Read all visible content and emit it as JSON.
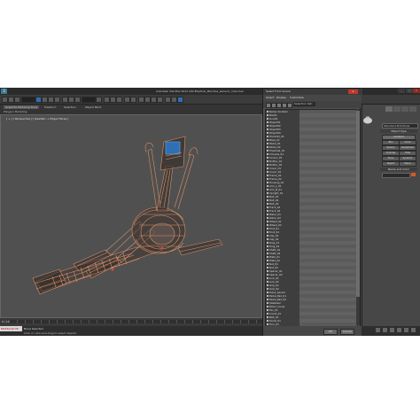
{
  "app": {
    "logo": "3",
    "title": "Autodesk 3ds Max 2013 x64     Elliptical_Machine_Generic_max.max"
  },
  "ribbon": {
    "tabs": [
      "Graphite Modeling Tools",
      "Freeform",
      "Selection",
      "Object Paint"
    ],
    "sub_label": "Polygon Modeling"
  },
  "viewport": {
    "label": "[ + ] [ Perspective ] [ Realistic + Edged Faces ]"
  },
  "timeline": {
    "counter": "0 / 100"
  },
  "status": {
    "maxscript": "MAXScript Mi",
    "line1": "None Selected",
    "line2": "Click or click-and-drag to select objects"
  },
  "command_panel": {
    "category": "Standard Primitives",
    "object_type_header": "Object Type",
    "autogrid": "AutoGrid",
    "buttons": [
      "Box",
      "Cone",
      "Sphere",
      "GeoSphere",
      "Cylinder",
      "Tube",
      "Torus",
      "Pyramid",
      "Teapot",
      "Plane"
    ],
    "name_color_header": "Name and Color",
    "colors": [
      "#2a6cc7",
      "#d85a2a"
    ]
  },
  "select_dialog": {
    "title": "Select From Scene",
    "close_label": "x",
    "menu": [
      "Select",
      "Display",
      "Customize"
    ],
    "selection_set_label": "Selection Set:",
    "ok_label": "OK",
    "cancel_label": "Cancel",
    "objects": [
      "Name (Sorted)",
      "Box01",
      "Line01",
      "Object01",
      "Object02",
      "Object03",
      "Object04",
      "Handrail_01",
      "Base_01",
      "Pedal_01",
      "Pedal_02",
      "Flywheel_01",
      "Console_01",
      "Screen_01",
      "Button_01",
      "Button_02",
      "Cover_01",
      "Cover_02",
      "Frame_01",
      "Frame_02",
      "Housing_01",
      "Arm_L_01",
      "Arm_R_01",
      "Upright_01",
      "Bolt_01",
      "Bolt_02",
      "Bolt_03",
      "Track_01",
      "Track_02",
      "Roller_01",
      "Roller_02",
      "Wheel_01",
      "Wheel_02",
      "Foot_01",
      "Foot_02",
      "Cap_01",
      "Cap_02",
      "Ring_01",
      "Ring_02",
      "Shaft_01",
      "Shaft_02",
      "Plate_01",
      "Plate_02",
      "Nut_01",
      "Nut_02",
      "Spacer_01",
      "Spacer_02",
      "Link_01",
      "Link_02",
      "Grip_01",
      "Grip_02",
      "Pulse_Sensor",
      "Pedal_Pad_01",
      "Pedal_Pad_02",
      "Stabilizer",
      "Motor_Cover",
      "Fan_01",
      "Crank_01",
      "Belt_01",
      "Decal_01",
      "Trim_01",
      "Trim_02"
    ]
  }
}
